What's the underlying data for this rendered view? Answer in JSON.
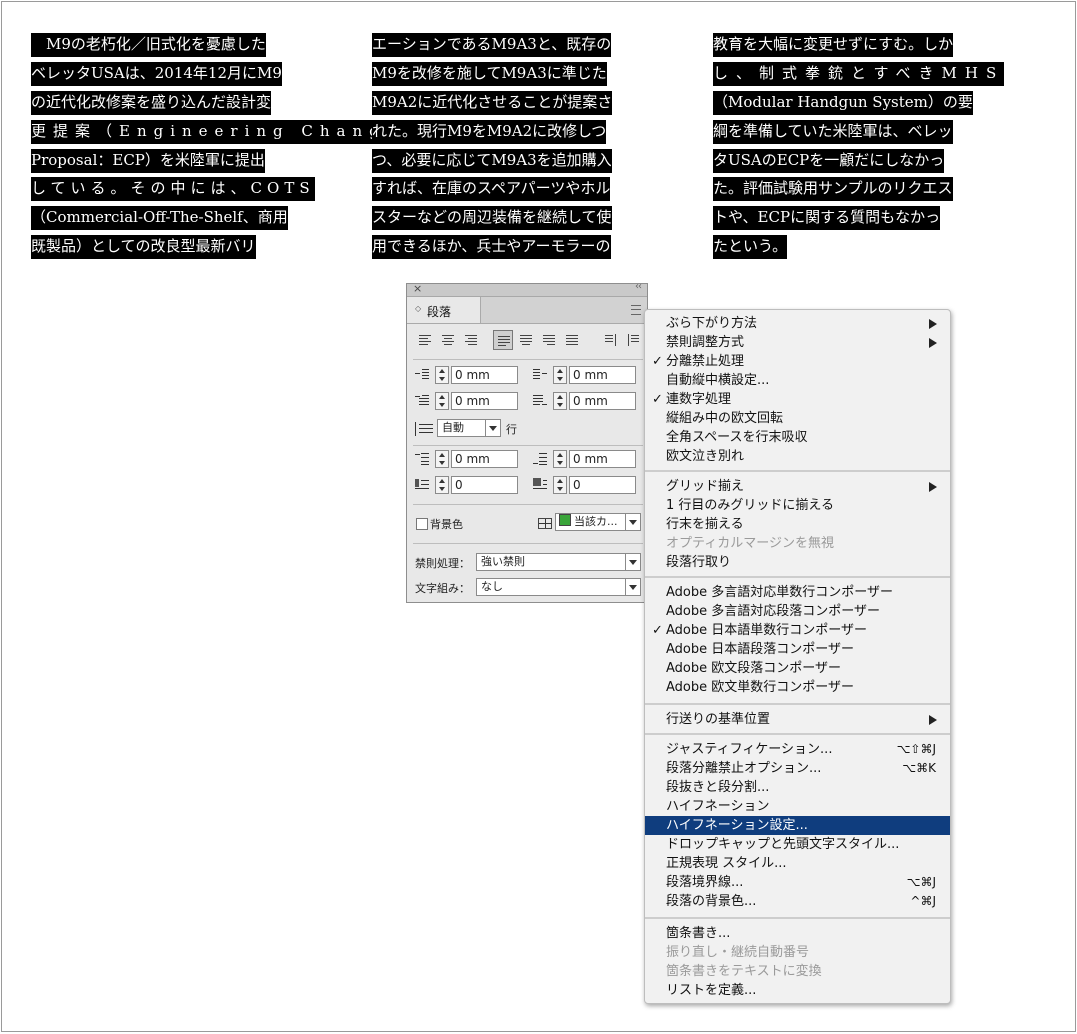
{
  "body_text": {
    "col1": [
      "　M9の老朽化／旧式化を憂慮した",
      "ベレッタUSAは、2014年12月にM9",
      "の近代化改修案を盛り込んだ設計変",
      "更提案（Engineering Change",
      "Proposal：ECP）を米陸軍に提出",
      "している。その中には、COTS",
      "（Commercial-Off-The-Shelf、商用",
      "既製品）としての改良型最新バリ"
    ],
    "col2": [
      "エーションであるM9A3と、既存の",
      "M9を改修を施してM9A3に準じた",
      "M9A2に近代化させることが提案さ",
      "れた。現行M9をM9A2に改修しつ",
      "つ、必要に応じてM9A3を追加購入",
      "すれば、在庫のスペアパーツやホル",
      "スターなどの周辺装備を継続して使",
      "用できるほか、兵士やアーモラーの"
    ],
    "col3": [
      "教育を大幅に変更せずにすむ。しか",
      "し、制式拳銃とすべきMHS",
      "（Modular Handgun System）の要",
      "綱を準備していた米陸軍は、ベレッ",
      "タUSAのECPを一顧だにしなかっ",
      "た。評価試験用サンプルのリクエス",
      "トや、ECPに関する質問もなかっ",
      "たという。"
    ]
  },
  "panel": {
    "close_glyph": "×",
    "collapse_glyph": "‹‹",
    "tab_arrow": "◇",
    "tab_label": "段落",
    "fields": {
      "left_indent": "0 mm",
      "right_indent": "0 mm",
      "first_line_indent": "0 mm",
      "last_line_right_indent": "0 mm",
      "space_before": "0 mm",
      "space_after": "0 mm",
      "drop_cap_lines": "0",
      "drop_cap_chars": "0"
    },
    "leading_value": "自動",
    "leading_unit": "行",
    "background_color_label": "背景色",
    "bg_color_value": "当該カ...",
    "kinsoku_label": "禁則処理：",
    "kinsoku_value": "強い禁則",
    "mojikumi_label": "文字組み：",
    "mojikumi_value": "なし",
    "swatch_color": "#3aa53a"
  },
  "menu": {
    "highlight_color": "#0f3d7e",
    "checkmark": "✓",
    "items": [
      {
        "label": "ぶら下がり方法",
        "submenu": true
      },
      {
        "label": "禁則調整方式",
        "submenu": true
      },
      {
        "label": "分離禁止処理",
        "checked": true
      },
      {
        "label": "自動縦中横設定..."
      },
      {
        "label": "連数字処理",
        "checked": true
      },
      {
        "label": "縦組み中の欧文回転"
      },
      {
        "label": "全角スペースを行末吸収"
      },
      {
        "label": "欧文泣き別れ"
      },
      {
        "label": "グリッド揃え",
        "submenu": true
      },
      {
        "label": "1 行目のみグリッドに揃える"
      },
      {
        "label": "行末を揃える"
      },
      {
        "label": "オプティカルマージンを無視",
        "disabled": true
      },
      {
        "label": "段落行取り"
      },
      {
        "label": "Adobe 多言語対応単数行コンポーザー"
      },
      {
        "label": "Adobe 多言語対応段落コンポーザー"
      },
      {
        "label": "Adobe 日本語単数行コンポーザー",
        "checked": true
      },
      {
        "label": "Adobe 日本語段落コンポーザー"
      },
      {
        "label": "Adobe 欧文段落コンポーザー"
      },
      {
        "label": "Adobe 欧文単数行コンポーザー"
      },
      {
        "label": "行送りの基準位置",
        "submenu": true
      },
      {
        "label": "ジャスティフィケーション...",
        "shortcut": "⌥⇧⌘J"
      },
      {
        "label": "段落分離禁止オプション...",
        "shortcut": "⌥⌘K"
      },
      {
        "label": "段抜きと段分割..."
      },
      {
        "label": "ハイフネーション"
      },
      {
        "label": "ハイフネーション設定...",
        "highlighted": true
      },
      {
        "label": "ドロップキャップと先頭文字スタイル..."
      },
      {
        "label": "正規表現 スタイル..."
      },
      {
        "label": "段落境界線...",
        "shortcut": "⌥⌘J"
      },
      {
        "label": "段落の背景色...",
        "shortcut": "^⌘J"
      },
      {
        "label": "箇条書き..."
      },
      {
        "label": "振り直し・継続自動番号",
        "disabled": true
      },
      {
        "label": "箇条書きをテキストに変換",
        "disabled": true
      },
      {
        "label": "リストを定義..."
      }
    ]
  }
}
